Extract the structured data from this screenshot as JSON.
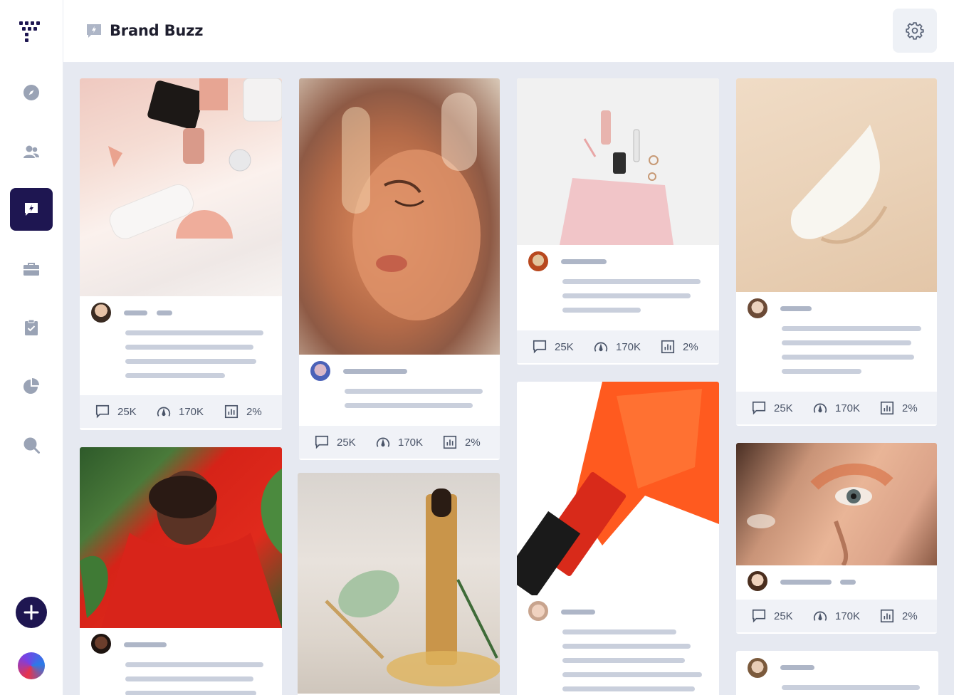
{
  "app": {
    "page_title": "Brand Buzz"
  },
  "sidebar": {
    "logo": "grid-logo-icon",
    "items": [
      {
        "icon": "compass-icon",
        "label": "Explore"
      },
      {
        "icon": "users-icon",
        "label": "Creators"
      },
      {
        "icon": "brand-buzz-icon",
        "label": "Brand Buzz",
        "active": true
      },
      {
        "icon": "briefcase-icon",
        "label": "Campaigns"
      },
      {
        "icon": "clipboard-check-icon",
        "label": "Tasks"
      },
      {
        "icon": "pie-chart-icon",
        "label": "Analytics"
      },
      {
        "icon": "search-icon",
        "label": "Search"
      }
    ],
    "add_icon": "plus-icon"
  },
  "header": {
    "settings_icon": "gear-icon"
  },
  "colors": {
    "accent": "#1e1651",
    "placeholder": "#c9cfdc",
    "canvas": "#e6e9f1"
  },
  "posts": [
    {
      "comments": "25K",
      "reach": "170K",
      "engagement": "2%"
    },
    {
      "comments": "25K",
      "reach": "170K",
      "engagement": "2%"
    },
    {
      "comments": "25K",
      "reach": "170K",
      "engagement": "2%"
    },
    {
      "comments": "25K",
      "reach": "170K",
      "engagement": "2%"
    },
    {
      "comments": "25K",
      "reach": "170K",
      "engagement": "2%"
    },
    {
      "comments": "",
      "reach": "",
      "engagement": ""
    },
    {
      "comments": "",
      "reach": "",
      "engagement": ""
    },
    {
      "comments": "",
      "reach": "",
      "engagement": ""
    },
    {
      "comments": "",
      "reach": "",
      "engagement": ""
    }
  ]
}
